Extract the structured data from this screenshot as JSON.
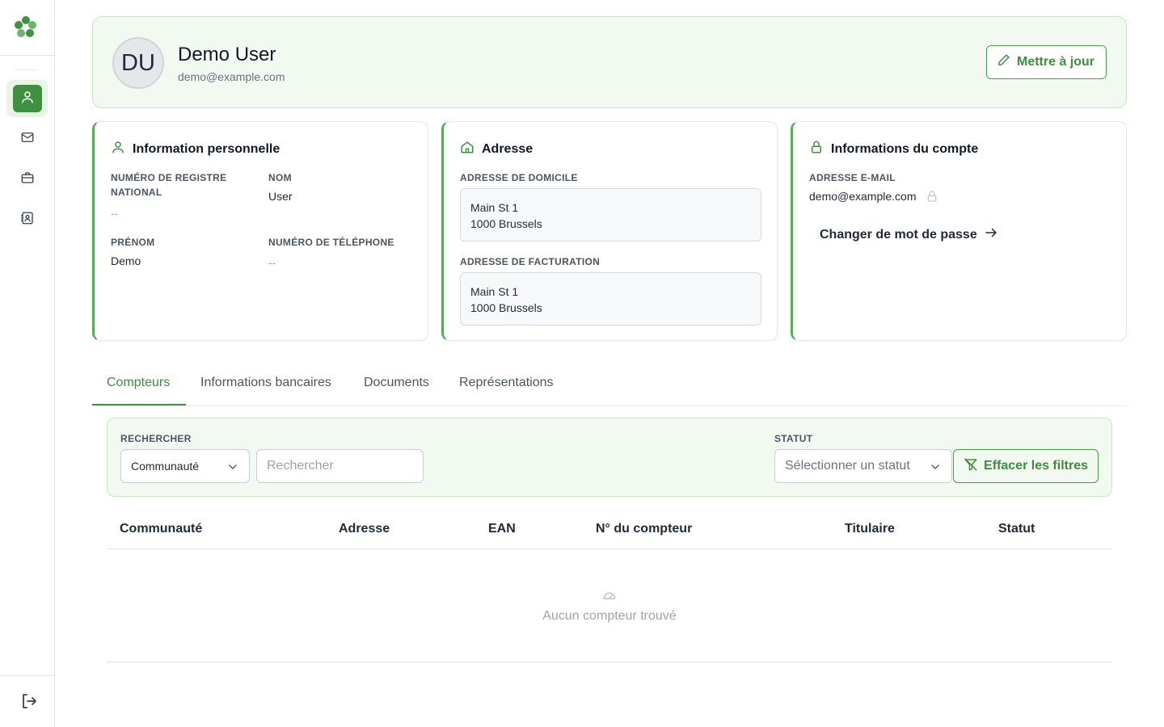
{
  "sidebar": {
    "items": [
      {
        "icon": "user-icon",
        "active": true
      },
      {
        "icon": "mail-icon",
        "active": false
      },
      {
        "icon": "briefcase-icon",
        "active": false
      },
      {
        "icon": "contact-card-icon",
        "active": false
      }
    ],
    "logout_icon": "logout-icon"
  },
  "profile": {
    "initials": "DU",
    "name": "Demo User",
    "email": "demo@example.com",
    "update_label": "Mettre à jour"
  },
  "personal": {
    "title": "Information personnelle",
    "national_id_label": "NUMÉRO DE REGISTRE NATIONAL",
    "national_id_value": "--",
    "last_name_label": "NOM",
    "last_name_value": "User",
    "first_name_label": "PRÉNOM",
    "first_name_value": "Demo",
    "phone_label": "NUMÉRO DE TÉLÉPHONE",
    "phone_value": "--"
  },
  "address": {
    "title": "Adresse",
    "home_label": "ADRESSE DE DOMICILE",
    "home_line1": "Main St 1",
    "home_line2": "1000 Brussels",
    "billing_label": "ADRESSE DE FACTURATION",
    "billing_line1": "Main St 1",
    "billing_line2": "1000 Brussels"
  },
  "account": {
    "title": "Informations du compte",
    "email_label": "ADRESSE E-MAIL",
    "email_value": "demo@example.com",
    "change_password": "Changer de mot de passe"
  },
  "tabs": [
    {
      "label": "Compteurs",
      "active": true
    },
    {
      "label": "Informations bancaires",
      "active": false
    },
    {
      "label": "Documents",
      "active": false
    },
    {
      "label": "Représentations",
      "active": false
    }
  ],
  "filters": {
    "search_label": "RECHERCHER",
    "search_field_select": "Communauté",
    "search_placeholder": "Rechercher",
    "status_label": "STATUT",
    "status_placeholder": "Sélectionner un statut",
    "clear_label": "Effacer les filtres"
  },
  "table": {
    "columns": [
      "Communauté",
      "Adresse",
      "EAN",
      "N° du compteur",
      "Titulaire",
      "Statut"
    ],
    "empty_text": "Aucun compteur trouvé"
  },
  "colors": {
    "accent": "#3f9142",
    "accent_light": "#f2f9f0",
    "border_green": "#c9e6c3"
  }
}
